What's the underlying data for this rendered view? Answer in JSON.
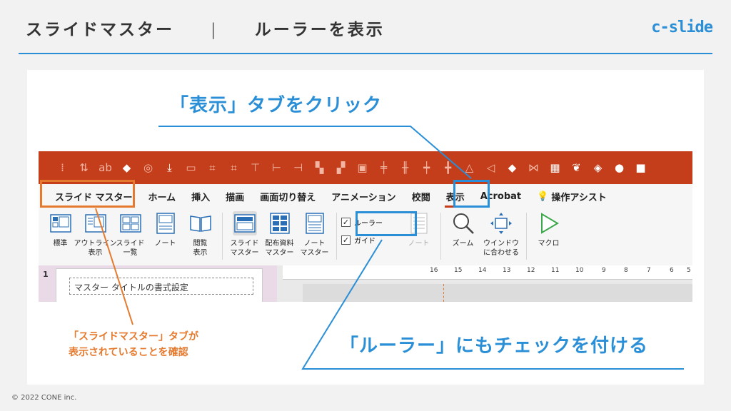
{
  "header": {
    "title_main": "スライドマスター",
    "separator": "|",
    "title_sub": "ルーラーを表示",
    "brand": "c-slide"
  },
  "callouts": {
    "view_tab": "「表示」タブをクリック",
    "ruler_check": "「ルーラー」にもチェックを付ける",
    "master_tab_line1": "「スライドマスター」タブが",
    "master_tab_line2": "表示されていることを確認"
  },
  "tabs": [
    "スライド マスター",
    "ホーム",
    "挿入",
    "描画",
    "画面切り替え",
    "アニメーション",
    "校閲",
    "表示",
    "Acrobat",
    "操作アシスト"
  ],
  "ribbon": {
    "normal": "標準",
    "outline_1": "アウトライン",
    "outline_2": "表示",
    "sorter_1": "スライド",
    "sorter_2": "一覧",
    "notes": "ノート",
    "reading_1": "閲覧",
    "reading_2": "表示",
    "slide_master_1": "スライド",
    "slide_master_2": "マスター",
    "handout_master_1": "配布資料",
    "handout_master_2": "マスター",
    "notes_master_1": "ノート",
    "notes_master_2": "マスター",
    "ruler": "ルーラー",
    "guides": "ガイド",
    "notes_disabled": "ノート",
    "zoom": "ズーム",
    "fit_1": "ウインドウ",
    "fit_2": "に合わせる",
    "macro": "マクロ"
  },
  "thumbnail": {
    "number": "1",
    "title_placeholder": "マスター タイトルの書式設定"
  },
  "ruler_ticks": [
    "16",
    "15",
    "14",
    "13",
    "12",
    "11",
    "10",
    "9",
    "8",
    "7",
    "6",
    "5"
  ],
  "colors": {
    "accent_blue": "#2a8fd6",
    "accent_orange": "#e57a2e",
    "office_red": "#c43e1c"
  },
  "footer": {
    "copyright": "© 2022 CONE inc."
  }
}
